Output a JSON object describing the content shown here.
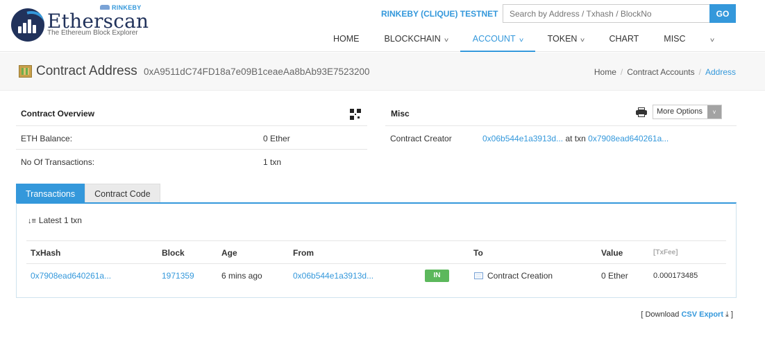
{
  "brand": {
    "name": "Etherscan",
    "tagline": "The Ethereum Block Explorer",
    "badge": "RINKEBY",
    "icon": "etherscan-logo"
  },
  "network_label": "RINKEBY (CLIQUE) TESTNET",
  "search": {
    "placeholder": "Search by Address / Txhash / BlockNo",
    "button": "GO"
  },
  "nav": [
    {
      "label": "HOME",
      "dropdown": false
    },
    {
      "label": "BLOCKCHAIN",
      "dropdown": true
    },
    {
      "label": "ACCOUNT",
      "dropdown": true,
      "active": true
    },
    {
      "label": "TOKEN",
      "dropdown": true
    },
    {
      "label": "CHART",
      "dropdown": false
    },
    {
      "label": "MISC",
      "dropdown": true
    }
  ],
  "page": {
    "title": "Contract Address",
    "address": "0xA9511dC74FD18a7e09B1ceaeAa8bAb93E7523200",
    "breadcrumb": [
      "Home",
      "Contract Accounts",
      "Address"
    ]
  },
  "overview": {
    "heading": "Contract Overview",
    "eth_balance_label": "ETH Balance:",
    "eth_balance": "0 Ether",
    "tx_count_label": "No Of Transactions:",
    "tx_count": "1 txn"
  },
  "misc": {
    "heading": "Misc",
    "more_options": "More Options",
    "creator_label": "Contract Creator",
    "creator": "0x06b544e1a3913d...",
    "at_txn": "at txn",
    "creation_tx": "0x7908ead640261a..."
  },
  "tabs": [
    "Transactions",
    "Contract Code"
  ],
  "transactions": {
    "summary": "Latest 1 txn",
    "headers": [
      "TxHash",
      "Block",
      "Age",
      "From",
      "To",
      "Value",
      "[TxFee]"
    ],
    "rows": [
      {
        "txhash": "0x7908ead640261a...",
        "block": "1971359",
        "age": "6 mins ago",
        "from": "0x06b544e1a3913d...",
        "direction": "IN",
        "to": "Contract Creation",
        "value": "0 Ether",
        "fee": "0.000173485"
      }
    ]
  },
  "csv": {
    "prefix": "[ Download",
    "link": "CSV Export",
    "suffix": "]"
  },
  "colors": {
    "accent": "#3498db",
    "in_badge": "#5cb85c",
    "brand_dark": "#21325b"
  }
}
